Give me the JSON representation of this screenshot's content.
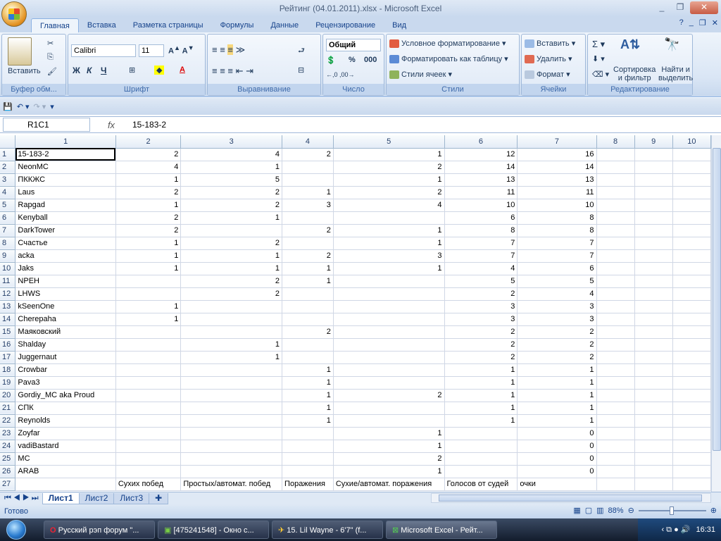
{
  "window": {
    "title": "Рейтинг (04.01.2011).xlsx - Microsoft Excel"
  },
  "tabs": [
    "Главная",
    "Вставка",
    "Разметка страницы",
    "Формулы",
    "Данные",
    "Рецензирование",
    "Вид"
  ],
  "ribbon": {
    "clipboard": {
      "name": "Буфер обм...",
      "paste": "Вставить"
    },
    "font": {
      "name": "Шрифт",
      "font_family": "Calibri",
      "font_size": "11"
    },
    "alignment": {
      "name": "Выравнивание"
    },
    "number": {
      "name": "Число",
      "format": "Общий",
      "percent": "%",
      "thousands": "000"
    },
    "styles": {
      "name": "Стили",
      "conditional": "Условное форматирование",
      "as_table": "Форматировать как таблицу",
      "cell_styles": "Стили ячеек"
    },
    "cells": {
      "name": "Ячейки",
      "insert": "Вставить",
      "delete": "Удалить",
      "format": "Формат"
    },
    "editing": {
      "name": "Редактирование",
      "sort": "Сортировка\nи фильтр",
      "find": "Найти и\nвыделить"
    }
  },
  "formula_bar": {
    "name_box": "R1C1",
    "fx": "fx",
    "formula": "15-183-2"
  },
  "columns": [
    "1",
    "2",
    "3",
    "4",
    "5",
    "6",
    "7",
    "8",
    "9",
    "10"
  ],
  "rows": [
    [
      "15-183-2",
      "2",
      "4",
      "2",
      "1",
      "12",
      "16"
    ],
    [
      "NeonMC",
      "4",
      "1",
      "",
      "2",
      "14",
      "14"
    ],
    [
      "ПККЖС",
      "1",
      "5",
      "",
      "1",
      "13",
      "13"
    ],
    [
      "Laus",
      "2",
      "2",
      "1",
      "2",
      "11",
      "11"
    ],
    [
      "Rapgad",
      "1",
      "2",
      "3",
      "4",
      "10",
      "10"
    ],
    [
      "Kenyball",
      "2",
      "1",
      "",
      "",
      "6",
      "8"
    ],
    [
      "DarkTower",
      "2",
      "",
      "2",
      "1",
      "8",
      "8"
    ],
    [
      "Счастье",
      "1",
      "2",
      "",
      "1",
      "7",
      "7"
    ],
    [
      "аcka",
      "1",
      "1",
      "2",
      "3",
      "7",
      "7"
    ],
    [
      "Jaks",
      "1",
      "1",
      "1",
      "1",
      "4",
      "6"
    ],
    [
      "NPEH",
      "",
      "2",
      "1",
      "",
      "5",
      "5"
    ],
    [
      "LHWS",
      "",
      "2",
      "",
      "",
      "2",
      "4"
    ],
    [
      "kSeenOne",
      "1",
      "",
      "",
      "",
      "3",
      "3"
    ],
    [
      "Cherepaha",
      "1",
      "",
      "",
      "",
      "3",
      "3"
    ],
    [
      "Маяковский",
      "",
      "",
      "2",
      "",
      "2",
      "2"
    ],
    [
      "Shalday",
      "",
      "1",
      "",
      "",
      "2",
      "2"
    ],
    [
      "Juggernaut",
      "",
      "1",
      "",
      "",
      "2",
      "2"
    ],
    [
      "Crowbar",
      "",
      "",
      "1",
      "",
      "1",
      "1"
    ],
    [
      "Pava3",
      "",
      "",
      "1",
      "",
      "1",
      "1"
    ],
    [
      "Gordiy_MC aka Proud",
      "",
      "",
      "1",
      "2",
      "1",
      "1"
    ],
    [
      "СПК",
      "",
      "",
      "1",
      "",
      "1",
      "1"
    ],
    [
      "Reynolds",
      "",
      "",
      "1",
      "",
      "1",
      "1"
    ],
    [
      "Zoyfar",
      "",
      "",
      "",
      "1",
      "",
      "0"
    ],
    [
      "vadiBastard",
      "",
      "",
      "",
      "1",
      "",
      "0"
    ],
    [
      "МС",
      "",
      "",
      "",
      "2",
      "",
      "0"
    ],
    [
      "ARAB",
      "",
      "",
      "",
      "1",
      "",
      "0"
    ],
    [
      "",
      "Сухих побед",
      "Простых/автомат. побед",
      "Поражения",
      "Сухие/автомат. поражения",
      "Голосов от судей",
      "очки"
    ]
  ],
  "sheets": [
    "Лист1",
    "Лист2",
    "Лист3"
  ],
  "status": {
    "ready": "Готово",
    "zoom": "88%"
  },
  "taskbar": {
    "items": [
      "Русский рэп форум \"...",
      "[475241548] - Окно с...",
      "15. Lil Wayne - 6'7\" (f...",
      "Microsoft Excel - Рейт..."
    ],
    "time": "16:31"
  }
}
